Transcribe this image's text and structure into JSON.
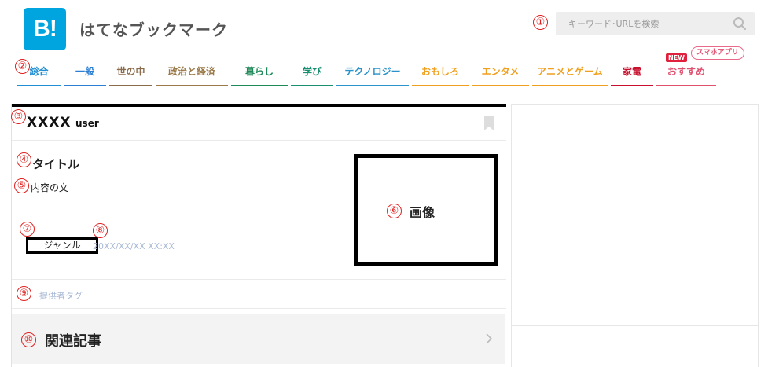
{
  "header": {
    "logo_text": "B!",
    "site_name": "はてなブックマーク",
    "search_placeholder": "キーワード･URLを検索",
    "search_icon": "search-icon"
  },
  "nav": {
    "items": [
      {
        "label": "総合",
        "color": "#1f8ed2"
      },
      {
        "label": "一般",
        "color": "#2a7fd4"
      },
      {
        "label": "世の中",
        "color": "#8a6c4c"
      },
      {
        "label": "政治と経済",
        "color": "#9b7a4a"
      },
      {
        "label": "暮らし",
        "color": "#1e8a5a"
      },
      {
        "label": "学び",
        "color": "#1b8f72"
      },
      {
        "label": "テクノロジー",
        "color": "#2a93c9"
      },
      {
        "label": "おもしろ",
        "color": "#f0a020"
      },
      {
        "label": "エンタメ",
        "color": "#f0a020"
      },
      {
        "label": "アニメとゲーム",
        "color": "#f0a020"
      },
      {
        "label": "家電",
        "color": "#c8102e"
      },
      {
        "label": "おすすめ",
        "color": "#e0506f"
      }
    ],
    "new_badge": "NEW",
    "app_badge": "スマホアプリ"
  },
  "markers": [
    "①",
    "②",
    "③",
    "④",
    "⑤",
    "⑥",
    "⑦",
    "⑧",
    "⑨",
    "⑩"
  ],
  "entry": {
    "user_count": "XXXX",
    "user_unit": "user",
    "title": "タイトル",
    "body": "内容の文",
    "genre": "ジャンル",
    "date": "20XX/XX/XX XX:XX",
    "image_label": "画像",
    "provider_tag": "提供者タグ",
    "related_label": "関連記事"
  }
}
